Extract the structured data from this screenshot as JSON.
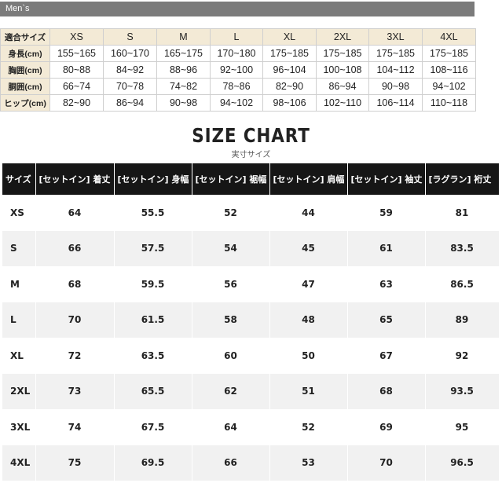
{
  "mens": {
    "banner": "Men`s",
    "header_label": "適合サイズ",
    "sizes": [
      "XS",
      "S",
      "M",
      "L",
      "XL",
      "2XL",
      "3XL",
      "4XL"
    ],
    "rows": [
      {
        "label": "身長(cm)",
        "values": [
          "155~165",
          "160~170",
          "165~175",
          "170~180",
          "175~185",
          "175~185",
          "175~185",
          "175~185"
        ]
      },
      {
        "label": "胸囲(cm)",
        "values": [
          "80~88",
          "84~92",
          "88~96",
          "92~100",
          "96~104",
          "100~108",
          "104~112",
          "108~116"
        ]
      },
      {
        "label": "胴囲(cm)",
        "values": [
          "66~74",
          "70~78",
          "74~82",
          "78~86",
          "82~90",
          "86~94",
          "90~98",
          "94~102"
        ]
      },
      {
        "label": "ヒップ(cm)",
        "values": [
          "82~90",
          "86~94",
          "90~98",
          "94~102",
          "98~106",
          "102~110",
          "106~114",
          "110~118"
        ]
      }
    ]
  },
  "size_chart": {
    "title": "SIZE CHART",
    "subtitle": "実寸サイズ",
    "headers": [
      "サイズ",
      "[セットイン] 着丈",
      "[セットイン] 身幅",
      "[セットイン] 裾幅",
      "[セットイン] 肩幅",
      "[セットイン] 袖丈",
      "[ラグラン] 裄丈"
    ],
    "rows": [
      {
        "size": "XS",
        "values": [
          "64",
          "55.5",
          "52",
          "44",
          "59",
          "81"
        ]
      },
      {
        "size": "S",
        "values": [
          "66",
          "57.5",
          "54",
          "45",
          "61",
          "83.5"
        ]
      },
      {
        "size": "M",
        "values": [
          "68",
          "59.5",
          "56",
          "47",
          "63",
          "86.5"
        ]
      },
      {
        "size": "L",
        "values": [
          "70",
          "61.5",
          "58",
          "48",
          "65",
          "89"
        ]
      },
      {
        "size": "XL",
        "values": [
          "72",
          "63.5",
          "60",
          "50",
          "67",
          "92"
        ]
      },
      {
        "size": "2XL",
        "values": [
          "73",
          "65.5",
          "62",
          "51",
          "68",
          "93.5"
        ]
      },
      {
        "size": "3XL",
        "values": [
          "74",
          "67.5",
          "64",
          "52",
          "69",
          "95"
        ]
      },
      {
        "size": "4XL",
        "values": [
          "75",
          "69.5",
          "66",
          "53",
          "70",
          "96.5"
        ]
      }
    ]
  }
}
